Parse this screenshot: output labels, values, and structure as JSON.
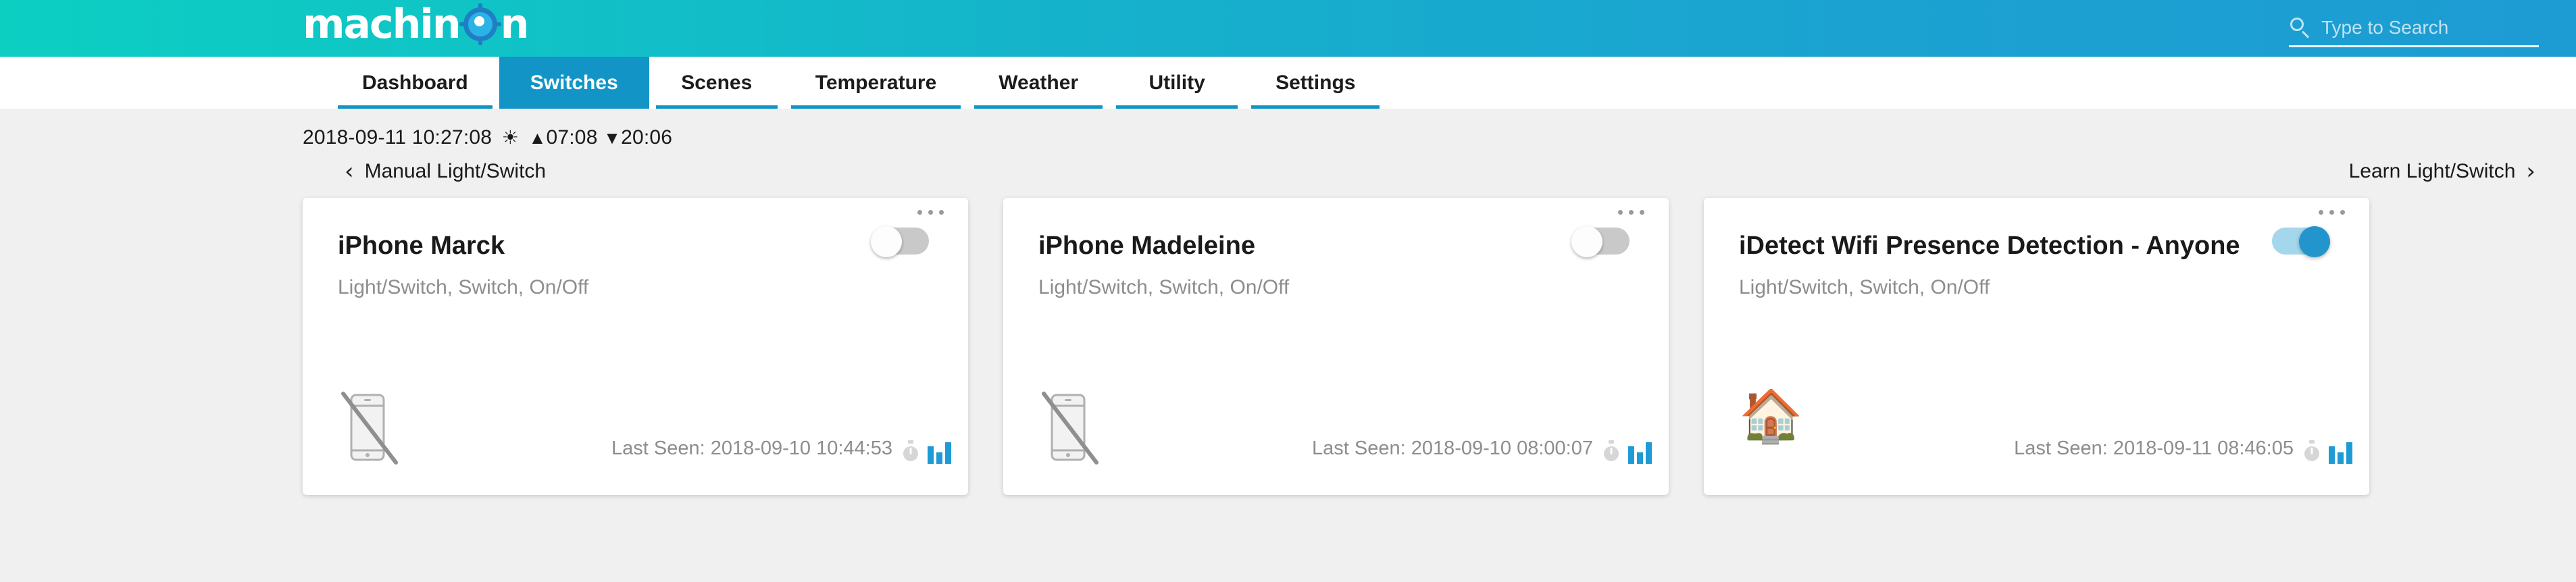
{
  "header": {
    "logo_text": "machinOn",
    "logo_part1": "machin",
    "logo_part2": "n",
    "search_placeholder": "Type to Search",
    "search_value": "",
    "gradient_start": "#0ccfc2",
    "gradient_end": "#1d9cd3"
  },
  "tabs": [
    {
      "label": "Dashboard",
      "active": false
    },
    {
      "label": "Switches",
      "active": true
    },
    {
      "label": "Scenes",
      "active": false
    },
    {
      "label": "Temperature",
      "active": false
    },
    {
      "label": "Weather",
      "active": false
    },
    {
      "label": "Utility",
      "active": false
    },
    {
      "label": "Settings",
      "active": false
    }
  ],
  "status": {
    "datetime": "2018-09-11 10:27:08",
    "sun_icon": "☀",
    "sunrise_arrow": "▲",
    "sunrise": "07:08",
    "sunset_arrow": "▼",
    "sunset": "20:06"
  },
  "nav": {
    "prev_label": "Manual Light/Switch",
    "prev_icon": "‹",
    "next_label": "Learn Light/Switch",
    "next_icon": "›"
  },
  "cards": [
    {
      "title": "iPhone Marck",
      "subtitle": "Light/Switch, Switch, On/Off",
      "toggle_state": "off",
      "device_icon": "phone-off-icon",
      "last_seen": "Last Seen: 2018-09-10 10:44:53"
    },
    {
      "title": "iPhone Madeleine",
      "subtitle": "Light/Switch, Switch, On/Off",
      "toggle_state": "off",
      "device_icon": "phone-off-icon",
      "last_seen": "Last Seen: 2018-09-10 08:00:07"
    },
    {
      "title": "iDetect Wifi Presence Detection - Anyone",
      "subtitle": "Light/Switch, Switch, On/Off",
      "toggle_state": "on",
      "device_icon": "house-icon",
      "device_glyph": "🏠",
      "last_seen": "Last Seen: 2018-09-11 08:46:05"
    }
  ],
  "colors": {
    "accent_blue": "#1295c6",
    "toggle_on_knob": "#2296cc",
    "toggle_on_track": "#a4d6ec",
    "toggle_off_track": "#c9c9c9",
    "bars_blue": "#1e9bd4",
    "page_bg": "#f0f0f0",
    "muted_text": "#8d8d8d"
  }
}
